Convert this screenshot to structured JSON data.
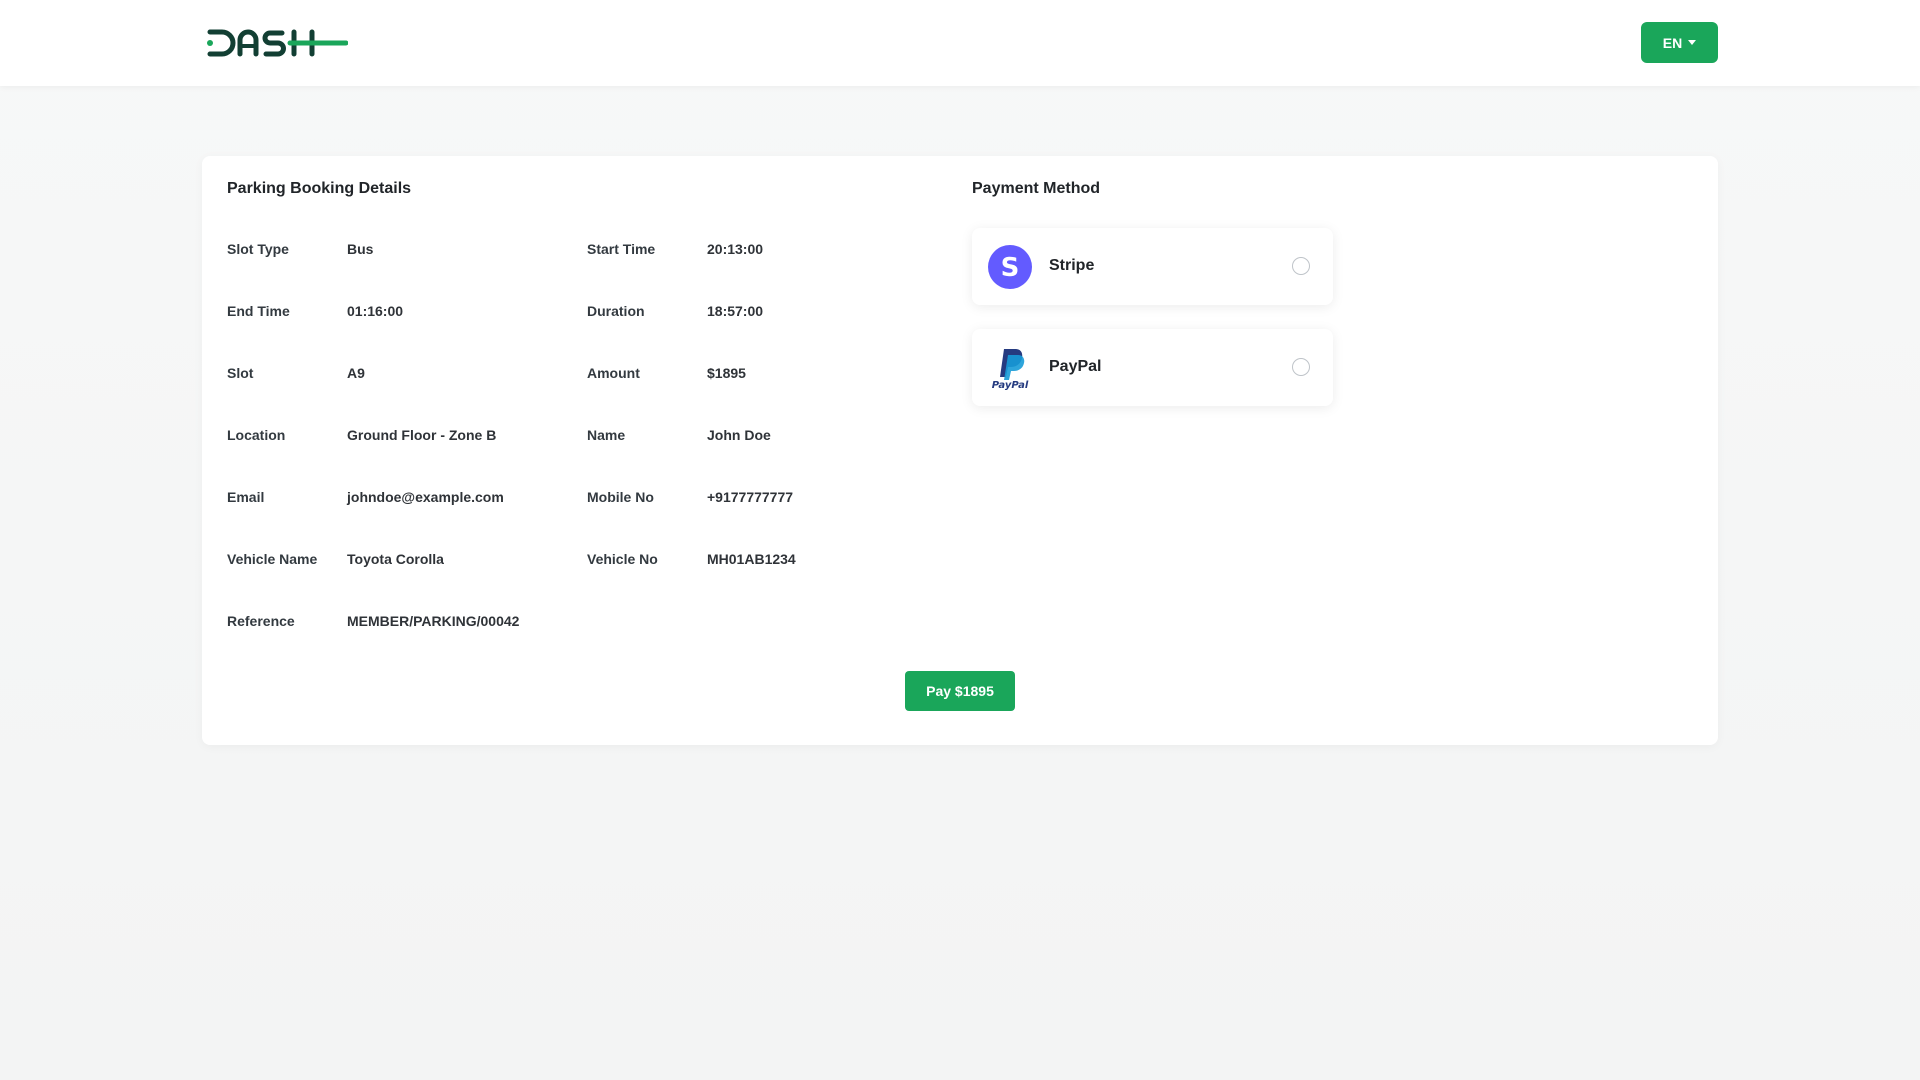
{
  "header": {
    "logo_text": "DASH",
    "language_label": "EN",
    "brand_color": "#1aa65a",
    "logo_dark_color": "#123f33"
  },
  "booking": {
    "title": "Parking Booking Details",
    "fields": [
      {
        "label": "Slot Type",
        "value": "Bus"
      },
      {
        "label": "Start Time",
        "value": "20:13:00"
      },
      {
        "label": "End Time",
        "value": "01:16:00"
      },
      {
        "label": "Duration",
        "value": "18:57:00"
      },
      {
        "label": "Slot",
        "value": "A9"
      },
      {
        "label": "Amount",
        "value": "$1895"
      },
      {
        "label": "Location",
        "value": "Ground Floor - Zone B"
      },
      {
        "label": "Name",
        "value": "John Doe"
      },
      {
        "label": "Email",
        "value": "johndoe@example.com"
      },
      {
        "label": "Mobile No",
        "value": "+9177777777"
      },
      {
        "label": "Vehicle Name",
        "value": "Toyota Corolla"
      },
      {
        "label": "Vehicle No",
        "value": "MH01AB1234"
      },
      {
        "label": "Reference",
        "value": "MEMBER/PARKING/00042"
      }
    ],
    "pay_button_label": "Pay $1895"
  },
  "payment": {
    "title": "Payment Method",
    "methods": [
      {
        "name": "Stripe",
        "icon": "stripe-icon",
        "color": "#635bff",
        "selected": false
      },
      {
        "name": "PayPal",
        "icon": "paypal-icon",
        "color": "#253b80",
        "selected": false
      }
    ]
  }
}
